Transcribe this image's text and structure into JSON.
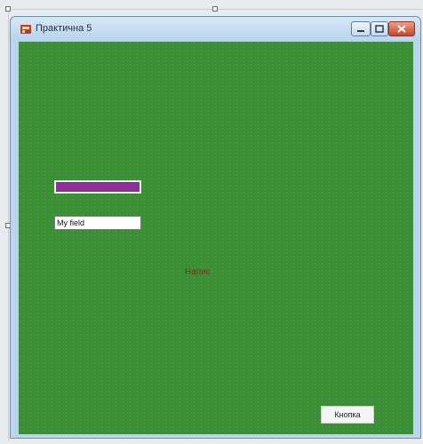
{
  "window": {
    "title": "Практична 5"
  },
  "form": {
    "progress_value": 1.0,
    "progress_color": "#8e2f95",
    "field_value": "My field",
    "label_text": "Напис",
    "label_color": "#8a2a22",
    "button_label": "Кнопка",
    "background_color": "#3a8f35"
  },
  "icons": {
    "app": "app-icon",
    "minimize": "minimize-icon",
    "maximize": "maximize-icon",
    "close": "close-icon"
  }
}
